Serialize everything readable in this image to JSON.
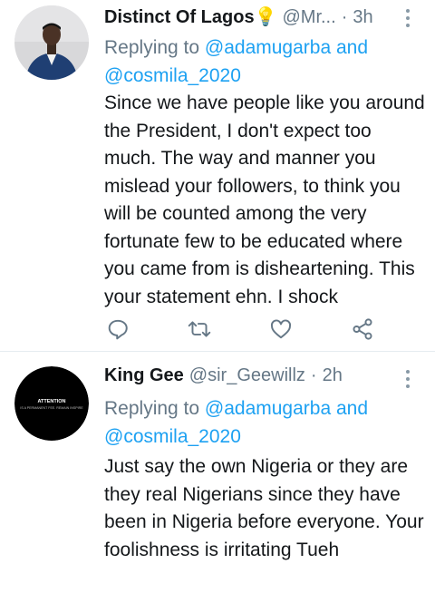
{
  "tweets": [
    {
      "name": "Distinct Of Lagos",
      "name_emoji": "💡",
      "handle": "@Mr...",
      "separator": "·",
      "time": "3h",
      "replying_prefix": "Replying to",
      "mention1": "@adamugarba",
      "conj": "and",
      "mention2": "@cosmila_2020",
      "text": "Since we have people like you around the President, I don't expect too much. The way and manner you mislead your followers, to think you will be counted among the very fortunate few to be educated where you came from is disheartening. This your statement ehn. I shock"
    },
    {
      "name": "King Gee",
      "handle": "@sir_Geewillz",
      "separator": "·",
      "time": "2h",
      "replying_prefix": "Replying to",
      "mention1": "@adamugarba",
      "conj": "and",
      "mention2": "@cosmila_2020",
      "text": "Just say the own Nigeria or they are they real Nigerians since they have been in Nigeria before everyone. Your foolishness is irritating Tueh",
      "avatar_text1": "ATTENTION",
      "avatar_text2": "IS A PERMANENT FEE. REMAIN INSPIRE"
    }
  ],
  "colors": {
    "link": "#1da1f2",
    "secondary": "#657786",
    "icon": "#657786",
    "divider": "#e6ecf0"
  },
  "icons": [
    "reply-icon",
    "retweet-icon",
    "like-icon",
    "share-icon",
    "more-icon"
  ]
}
